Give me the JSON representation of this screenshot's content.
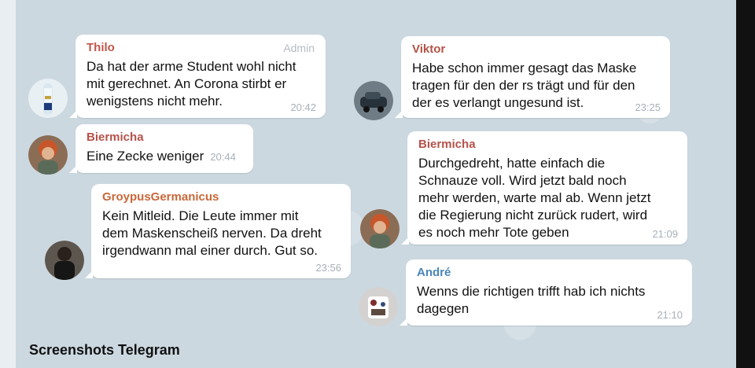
{
  "colors": {
    "thilo": "#c0574b",
    "biermicha": "#b5524a",
    "groypus": "#c8683a",
    "viktor": "#b35347",
    "andre": "#4a86b8"
  },
  "messages": [
    {
      "sender": "Thilo",
      "role": "Admin",
      "text": "Da hat der arme Student wohl nicht\nmit gerechnet. An Corona stirbt er\nwenigstens nicht mehr.",
      "time": "20:42",
      "avatar": "beer-bottle-icon"
    },
    {
      "sender": "Biermicha",
      "text": "Eine Zecke weniger",
      "time": "20:44",
      "avatar": "red-hair-avatar-icon"
    },
    {
      "sender": "GroypusGermanicus",
      "text": "Kein Mitleid. Die Leute immer mit\ndem Maskenscheiß nerven. Da dreht\nirgendwann mal einer durch. Gut so.",
      "time": "23:56",
      "avatar": "dark-figure-avatar-icon"
    },
    {
      "sender": "Viktor",
      "text": "Habe schon immer gesagt das Maske\ntragen für den der rs trägt und für den\nder es verlangt ungesund ist.",
      "time": "23:25",
      "avatar": "car-avatar-icon"
    },
    {
      "sender": "Biermicha",
      "text": "Durchgedreht, hatte einfach die\nSchnauze voll. Wird jetzt bald noch\nmehr werden, warte mal ab. Wenn jetzt\ndie Regierung nicht zurück rudert, wird\nes noch mehr Tote geben",
      "time": "21:09",
      "avatar": "red-hair-avatar-icon"
    },
    {
      "sender": "André",
      "text": "Wenns die richtigen trifft hab ich nichts\ndagegen",
      "time": "21:10",
      "avatar": "figure-avatar-icon"
    }
  ],
  "caption": "Screenshots Telegram"
}
